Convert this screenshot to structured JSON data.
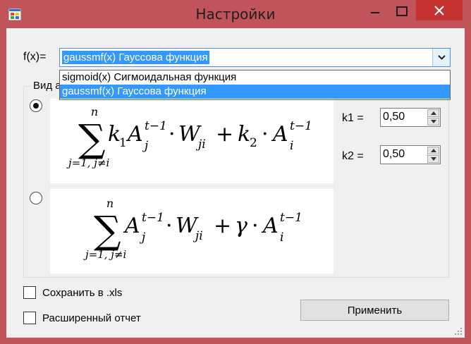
{
  "window": {
    "title": "Настройки",
    "colors": {
      "frame": "#c1545b",
      "close_button": "#c6322f",
      "selection": "#3399ff"
    }
  },
  "titlebar_icons": [
    "app-icon",
    "minimize-icon",
    "maximize-icon",
    "close-icon"
  ],
  "function_selector": {
    "label": "f(x)=",
    "selected": "gaussmf(x) Гауссова функция",
    "options": [
      {
        "label": "sigmoid(x) Сигмоидальная функция",
        "selected": false
      },
      {
        "label": "gaussmf(x) Гауссова функция",
        "selected": true
      }
    ]
  },
  "group": {
    "legend": "Вид а",
    "options": [
      {
        "checked": true,
        "formula": {
          "sum_upper": "n",
          "sum_lower": "j=1, j≠i",
          "sum_sign": "∑",
          "terms": {
            "k1": "k",
            "k1_sub": "1",
            "A": "A",
            "A_sub": "j",
            "A_sup": "t−1",
            "dot": "·",
            "W": "W",
            "W_sub": "ji",
            "plus": "+",
            "k2": "k",
            "k2_sub": "2",
            "A2": "A",
            "A2_sub": "i",
            "A2_sup": "t−1"
          }
        }
      },
      {
        "checked": false,
        "formula": {
          "sum_upper": "n",
          "sum_lower": "j=1, j≠i",
          "sum_sign": "∑",
          "terms": {
            "A": "A",
            "A_sub": "j",
            "A_sup": "t−1",
            "dot": "·",
            "W": "W",
            "W_sub": "ji",
            "plus": "+",
            "gamma": "γ",
            "A2": "A",
            "A2_sub": "i",
            "A2_sup": "t−1"
          }
        }
      }
    ],
    "k1": {
      "label": "k1 =",
      "value": "0,50"
    },
    "k2": {
      "label": "k2 =",
      "value": "0,50"
    }
  },
  "checkboxes": [
    {
      "label": "Сохранить в .xls",
      "checked": false
    },
    {
      "label": "Расширенный отчет",
      "checked": false
    }
  ],
  "apply_button": {
    "label": "Применить"
  }
}
